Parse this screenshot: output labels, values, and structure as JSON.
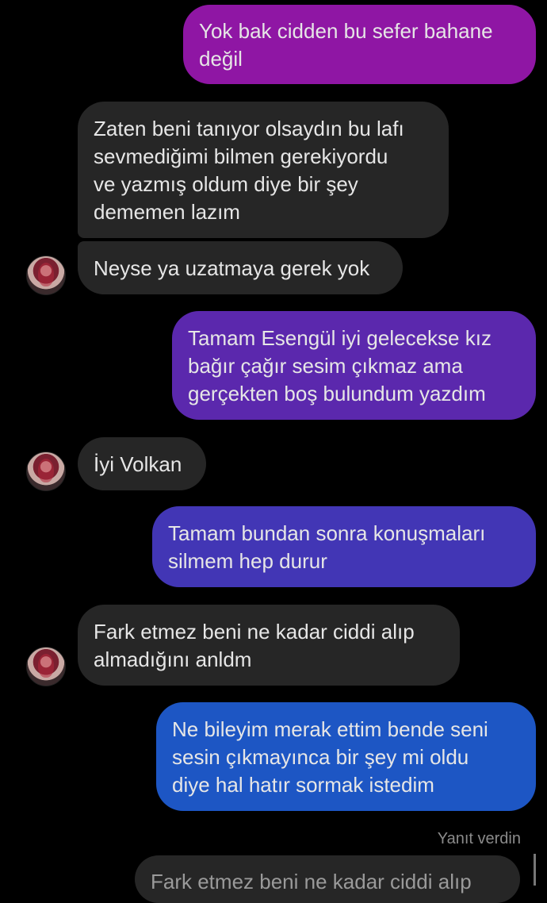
{
  "messages": [
    {
      "from": "me",
      "text": "Yok bak cidden bu sefer bahane\ndeğil",
      "color": "#8f16a4"
    },
    {
      "from": "other",
      "text": "Zaten beni tanıyor olsaydın bu lafı\nsevmediğimi bilmen gerekiyordu\nve yazmış oldum diye bir şey\ndememen lazım"
    },
    {
      "from": "other",
      "text": "Neyse ya uzatmaya gerek yok"
    },
    {
      "from": "me",
      "text": "Tamam Esengül iyi gelecekse kız\nbağır çağır sesim çıkmaz ama\ngerçekten boş bulundum yazdım",
      "color": "#5b28ad"
    },
    {
      "from": "other",
      "text": "İyi Volkan"
    },
    {
      "from": "me",
      "text": "Tamam bundan sonra konuşmaları\nsilmem hep durur",
      "color": "#4236b5"
    },
    {
      "from": "other",
      "text": "Fark etmez beni ne kadar ciddi alıp\nalmadığını anldm"
    },
    {
      "from": "me",
      "text": "Ne bileyim merak ettim bende seni\nsesin çıkmayınca bir şey mi oldu\ndiye hal hatır sormak istedim",
      "color": "#1d56c4"
    }
  ],
  "reply_status": "Yanıt verdin",
  "reply_preview": "Fark etmez beni ne kadar ciddi alıp"
}
